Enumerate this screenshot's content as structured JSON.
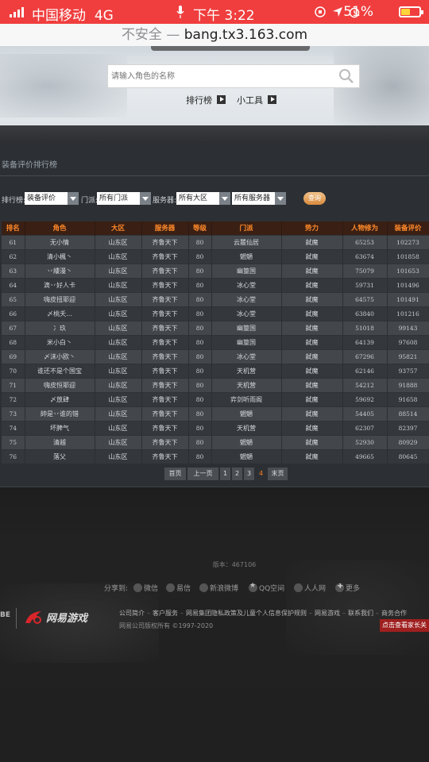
{
  "status_bar": {
    "carrier": "中国移动",
    "network": "4G",
    "time": "下午 3:22",
    "battery_percent": "51%",
    "battery_level": 0.51
  },
  "url_bar": {
    "insecure_label": "不安全",
    "separator": " — ",
    "host": "bang.tx3.163.com"
  },
  "hero": {
    "search_placeholder": "请输入角色的名称",
    "links": [
      "排行榜",
      "小工具"
    ]
  },
  "panel": {
    "title": "装备评价排行榜",
    "filters": {
      "rank_label": "排行榜:",
      "rank_value": "装备评价",
      "faction_label": "门派:",
      "faction_value": "所有门派",
      "server_label": "服务器:",
      "region_value": "所有大区",
      "server_value": "所有服务器"
    },
    "query_button": "查询"
  },
  "table": {
    "headers": [
      "排名",
      "角色",
      "大区",
      "服务器",
      "等级",
      "门派",
      "势力",
      "人物修为",
      "装备评价"
    ],
    "rows": [
      [
        "61",
        "无小情",
        "山东区",
        "齐鲁天下",
        "80",
        "云麓仙居",
        "弑魔",
        "65253",
        "102273"
      ],
      [
        "62",
        "清小楓丶",
        "山东区",
        "齐鲁天下",
        "80",
        "魍魉",
        "弑魔",
        "63674",
        "101858"
      ],
      [
        "63",
        "丷縷漫丶",
        "山东区",
        "齐鲁天下",
        "80",
        "幽篁国",
        "弑魔",
        "75079",
        "101653"
      ],
      [
        "64",
        "滴丷好人卡",
        "山东区",
        "齐鲁天下",
        "80",
        "冰心堂",
        "弑魔",
        "59731",
        "101496"
      ],
      [
        "65",
        "嗨皮扭耶迎",
        "山东区",
        "齐鲁天下",
        "80",
        "冰心堂",
        "弑魔",
        "64575",
        "101491"
      ],
      [
        "66",
        "〆桃夭...",
        "山东区",
        "齐鲁天下",
        "80",
        "冰心堂",
        "弑魔",
        "63840",
        "101216"
      ],
      [
        "67",
        "冫玖",
        "山东区",
        "齐鲁天下",
        "80",
        "幽篁国",
        "弑魔",
        "51018",
        "99143"
      ],
      [
        "68",
        "米小白丶",
        "山东区",
        "齐鲁天下",
        "80",
        "幽篁国",
        "弑魔",
        "64139",
        "97608"
      ],
      [
        "69",
        "〆沫小欧丶",
        "山东区",
        "齐鲁天下",
        "80",
        "冰心堂",
        "弑魔",
        "67296",
        "95821"
      ],
      [
        "70",
        "谁还不是个国宝",
        "山东区",
        "齐鲁天下",
        "80",
        "天机营",
        "弑魔",
        "62146",
        "93757"
      ],
      [
        "71",
        "嗨皮恒耶迎",
        "山东区",
        "齐鲁天下",
        "80",
        "天机营",
        "弑魔",
        "54212",
        "91888"
      ],
      [
        "72",
        "〆放肆",
        "山东区",
        "齐鲁天下",
        "80",
        "弈剑听雨阁",
        "弑魔",
        "59692",
        "91658"
      ],
      [
        "73",
        "帥是丷谁的错",
        "山东区",
        "齐鲁天下",
        "80",
        "魍魉",
        "弑魔",
        "54405",
        "88514"
      ],
      [
        "74",
        "坏脾气",
        "山东区",
        "齐鲁天下",
        "80",
        "天机营",
        "弑魔",
        "62307",
        "82397"
      ],
      [
        "75",
        "清越",
        "山东区",
        "齐鲁天下",
        "80",
        "魍魉",
        "弑魔",
        "52930",
        "80929"
      ],
      [
        "76",
        "落父",
        "山东区",
        "齐鲁天下",
        "80",
        "魍魉",
        "弑魔",
        "49665",
        "80645"
      ]
    ]
  },
  "pager": {
    "first": "首页",
    "prev": "上一页",
    "pages": [
      "1",
      "2",
      "3",
      "4"
    ],
    "current": "4",
    "last": "末页"
  },
  "footer": {
    "version": "版本：467106",
    "share_label": "分享到:",
    "share_items": [
      "微信",
      "易信",
      "新浪微博",
      "QQ空间",
      "人人网",
      "更多"
    ],
    "brand_left": "BE",
    "links": [
      "公司简介",
      "客户服务",
      "网易集团隐私政策及儿童个人信息保护规则",
      "网易游戏",
      "联系我们",
      "商务合作"
    ],
    "copyright": "网易公司版权所有 ©1997-2020",
    "parent_button": "点击查看家长关"
  },
  "colors": {
    "status_bar": "#f03e3e",
    "table_header_text": "#ff8a2a",
    "pager_current": "#ff7a1a",
    "parent_button": "#9f1f1f"
  }
}
